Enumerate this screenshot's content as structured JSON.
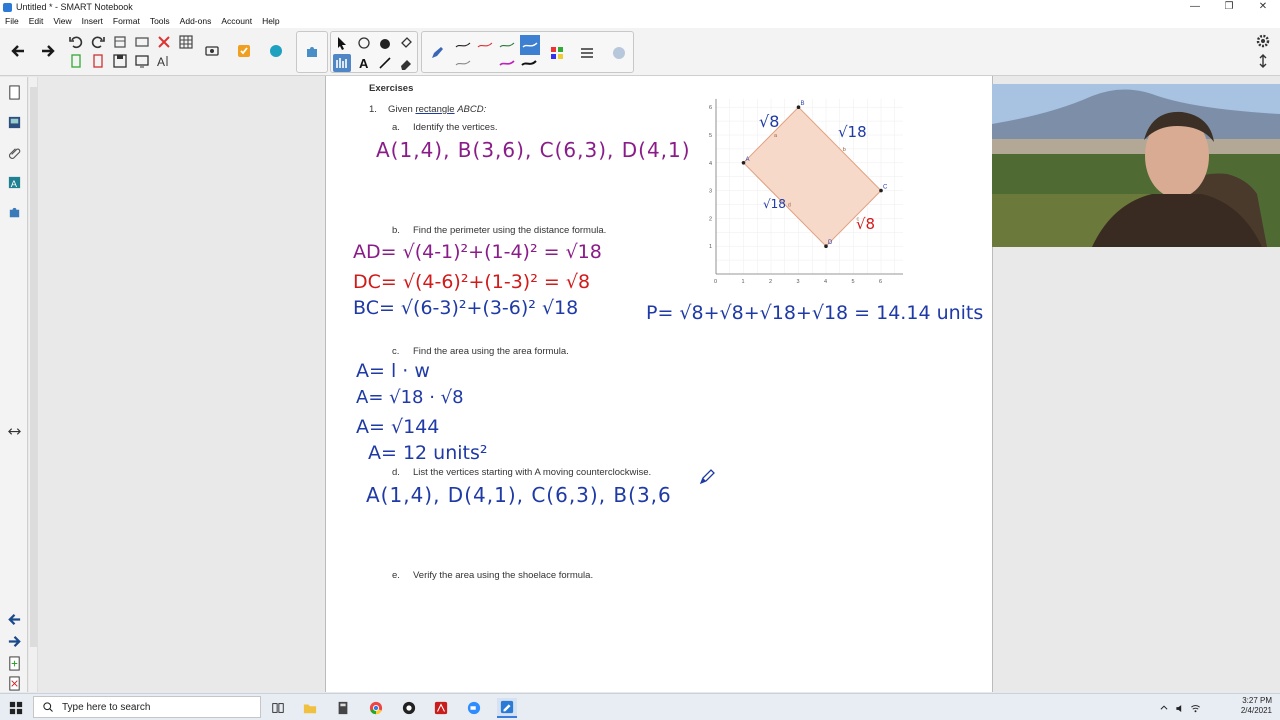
{
  "window": {
    "title": "Untitled * - SMART Notebook",
    "controls": [
      "—",
      "❐",
      "✕"
    ]
  },
  "menu": [
    "File",
    "Edit",
    "View",
    "Insert",
    "Format",
    "Tools",
    "Add-ons",
    "Account",
    "Help"
  ],
  "exercise": {
    "heading": "Exercises",
    "item1": "1.",
    "given": "Given",
    "given_underlined": "rectangle",
    "given_name": "ABCD:",
    "a_label": "a.",
    "a_text": "Identify the vertices.",
    "b_label": "b.",
    "b_text": "Find the perimeter using the distance formula.",
    "c_label": "c.",
    "c_text": "Find the area using the area formula.",
    "d_label": "d.",
    "d_text": "List the vertices starting with A moving counterclockwise.",
    "e_label": "e.",
    "e_text": "Verify the area using the shoelace formula."
  },
  "handwriting": {
    "vertices": "A(1,4), B(3,6), C(6,3), D(4,1)",
    "ad": "AD= √(4-1)²+(1-4)² = √18",
    "dc": "DC= √(4-6)²+(1-3)² = √8",
    "bc": "BC= √(6-3)²+(3-6)² √18",
    "perimeter": "P= √8+√8+√18+√18 = 14.14 units",
    "area1": "A= l · w",
    "area2": "A= √18 · √8",
    "area3": "A= √144",
    "area4": "A= 12 units²",
    "ccw": "A(1,4), D(4,1), C(6,3), B(3,6",
    "side_top_left": "√8",
    "side_top_right": "√18",
    "side_bottom_left": "√18",
    "side_bottom_right": "√8"
  },
  "graph": {
    "x_ticks": [
      "0",
      "1",
      "2",
      "3",
      "4",
      "5",
      "6"
    ],
    "y_ticks": [
      "0",
      "1",
      "2",
      "3",
      "4",
      "5",
      "6"
    ],
    "points": [
      {
        "name": "A",
        "x": 1,
        "y": 4
      },
      {
        "name": "B",
        "x": 3,
        "y": 6
      },
      {
        "name": "C",
        "x": 6,
        "y": 3
      },
      {
        "name": "D",
        "x": 4,
        "y": 1
      }
    ],
    "side_labels": [
      "a",
      "b",
      "c",
      "d"
    ],
    "fill_color": "#f6d9c8",
    "stroke_color": "#e0a080"
  },
  "taskbar": {
    "search_placeholder": "Type here to search",
    "time": "3:27 PM",
    "date": "2/4/2021"
  }
}
